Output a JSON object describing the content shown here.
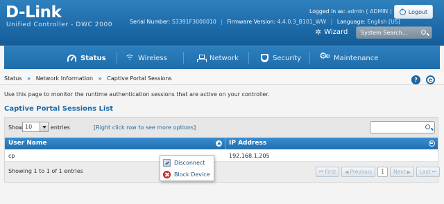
{
  "header": {
    "brand": "D-Link",
    "product": "Unified Controller - DWC 2000",
    "serial_label": "Serial Number:",
    "serial_value": "S3391F3000010",
    "firmware_label": "Firmware Version:",
    "firmware_value": "4.4.0.3_B101_WW",
    "language_label": "Language:",
    "language_value": "English [US]",
    "logged_in_label": "Logged in as:",
    "logged_in_user": "admin ( ADMIN )",
    "logout_label": "Logout",
    "wizard_label": "Wizard",
    "search_placeholder": "System Search..."
  },
  "nav": {
    "items": [
      {
        "label": "Status",
        "icon": "gauge-icon",
        "active": true
      },
      {
        "label": "Wireless",
        "icon": "wifi-icon",
        "active": false
      },
      {
        "label": "Network",
        "icon": "network-icon",
        "active": false
      },
      {
        "label": "Security",
        "icon": "shield-icon",
        "active": false
      },
      {
        "label": "Maintenance",
        "icon": "gears-icon",
        "active": false
      }
    ]
  },
  "breadcrumb": {
    "items": [
      "Status",
      "Network Information",
      "Captive Portal Sessions"
    ],
    "separator": "»"
  },
  "page": {
    "description": "Use this page to monitor the runtime authentication sessions that are active on your controller.",
    "section_title": "Captive Portal Sessions List"
  },
  "table": {
    "show_label": "Show",
    "page_size": "10",
    "entries_label": "entries",
    "hint": "[Right click row to see more options]",
    "columns": [
      "User Name",
      "IP Address"
    ],
    "rows": [
      {
        "user": "cp",
        "ip": "192.168.1.205"
      }
    ],
    "info": "Showing 1 to 1 of 1 entries",
    "pager": {
      "first": "First",
      "previous": "Previous",
      "page": "1",
      "next": "Next",
      "last": "Last"
    }
  },
  "context_menu": {
    "items": [
      {
        "label": "Disconnect",
        "icon": "disconnect-icon"
      },
      {
        "label": "Block Device",
        "icon": "block-icon"
      }
    ]
  },
  "colors": {
    "brand_blue": "#1d6aa8",
    "header_blue": "#2f81bd",
    "block_red": "#d93a3a"
  }
}
